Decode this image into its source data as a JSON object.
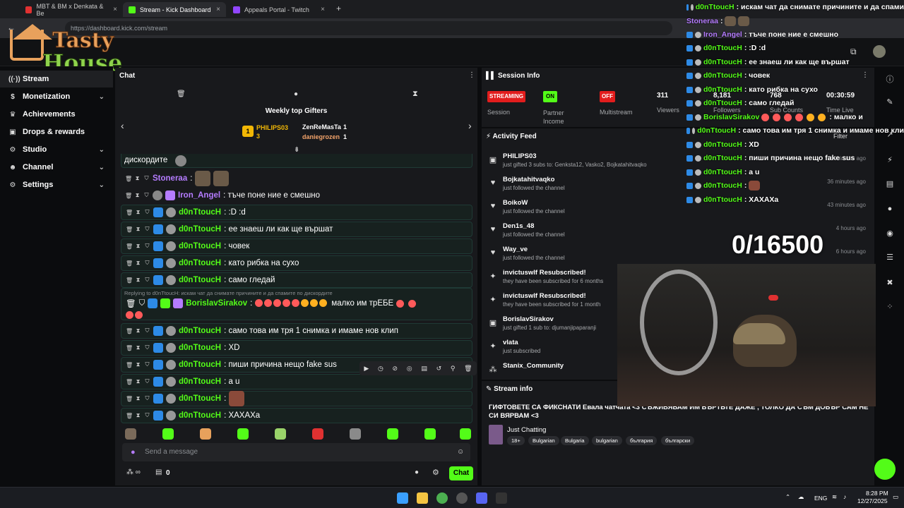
{
  "browser": {
    "tabs": [
      {
        "label": "MBT & BM x Denkata & Be",
        "fav": "#e03131"
      },
      {
        "label": "Stream - Kick Dashboard",
        "fav": "#53fc18"
      },
      {
        "label": "Appeals Portal - Twitch",
        "fav": "#9146ff"
      }
    ],
    "new_tab": "+",
    "url": "https://dashboard.kick.com/stream"
  },
  "overlay_logo": {
    "line1": "Tasty",
    "line2": "House"
  },
  "sidebar": {
    "items": [
      {
        "label": "Stream",
        "icon": "broadcast-icon",
        "glyph": "(·)",
        "chevron": ""
      },
      {
        "label": "Monetization",
        "icon": "dollar-icon",
        "glyph": "$",
        "chevron": "⌄"
      },
      {
        "label": "Achievements",
        "icon": "trophy-icon",
        "glyph": "🏆",
        "chevron": ""
      },
      {
        "label": "Drops & rewards",
        "icon": "gift-icon",
        "glyph": "🎁",
        "chevron": ""
      },
      {
        "label": "Studio",
        "icon": "gear-icon",
        "glyph": "⚙",
        "chevron": "⌄"
      },
      {
        "label": "Channel",
        "icon": "user-icon",
        "glyph": "👤",
        "chevron": "⌄"
      },
      {
        "label": "Settings",
        "icon": "gear-icon",
        "glyph": "⚙",
        "chevron": "⌄"
      }
    ]
  },
  "chat": {
    "title": "Chat",
    "gifters_title": "Weekly top Gifters",
    "gifters": [
      {
        "rank": "1",
        "name": "PHILIPS03",
        "count": "3"
      },
      {
        "name": "ZenReMasTa",
        "count": "1"
      },
      {
        "name": "daniegrozen",
        "count": "1"
      }
    ],
    "first_line": "дискордите",
    "messages": [
      {
        "user": "Stoneraa",
        "text": ":",
        "color": "purple"
      },
      {
        "user": "Iron_Angel",
        "text": ": тъче поне ние е смешно",
        "color": "purple"
      },
      {
        "user": "d0nTtoucH",
        "text": ": :D :d",
        "color": "green"
      },
      {
        "user": "d0nTtoucH",
        "text": ": ее знаеш ли как ще вършат",
        "color": "green"
      },
      {
        "user": "d0nTtoucH",
        "text": ": човек",
        "color": "green"
      },
      {
        "user": "d0nTtoucH",
        "text": ": като рибка на сухо",
        "color": "green"
      },
      {
        "user": "d0nTtoucH",
        "text": ": само гледай",
        "color": "green"
      }
    ],
    "reply_context": "Replying to d0nTtoucH: искам чат да снимате причините и да спамите по дискордите",
    "reply_user": "BorislavSirakov",
    "reply_text": "малко им трЕБЕ",
    "messages2": [
      {
        "user": "d0nTtoucH",
        "text": ": само това им тря 1 снимка и имаме нов клип"
      },
      {
        "user": "d0nTtoucH",
        "text": ": XD"
      },
      {
        "user": "d0nTtoucH",
        "text": ": пиши причина нещо fake sus"
      },
      {
        "user": "d0nTtoucH",
        "text": ": a u"
      },
      {
        "user": "d0nTtoucH",
        "text": ":"
      },
      {
        "user": "d0nTtoucH",
        "text": ": ХАХАХа"
      }
    ],
    "send_placeholder": "Send a message",
    "chat_button": "Chat",
    "footer_count": "0"
  },
  "session": {
    "title": "Session Info",
    "streaming": "STREAMING",
    "on": "ON",
    "off": "OFF",
    "labels": {
      "session": "Session",
      "partner": "Partner Income",
      "multistream": "Multistream",
      "viewers": "Viewers",
      "followers": "Followers",
      "subs": "Sub Counts",
      "time": "Time Live"
    },
    "viewers": "311",
    "followers": "8,181",
    "subs": "768",
    "time_live": "00:30:59",
    "colors": {
      "streaming": "#e21d1d",
      "on": "#53fc18",
      "off": "#e21d1d"
    }
  },
  "activity": {
    "title": "Activity Feed",
    "filter": "Filter",
    "items": [
      {
        "icon": "gift-icon",
        "name": "PHILIPS03",
        "desc": "just gifted 3 subs to: Genksta12, Vasko2, Bojkatahitvaqko",
        "time": "18 minutes ago"
      },
      {
        "icon": "heart-icon",
        "name": "Bojkatahitvaqko",
        "desc": "just followed the channel",
        "time": "36 minutes ago"
      },
      {
        "icon": "heart-icon",
        "name": "BoikoW",
        "desc": "just followed the channel",
        "time": "43 minutes ago"
      },
      {
        "icon": "heart-icon",
        "name": "Den1s_48",
        "desc": "just followed the channel",
        "time": "4 hours ago"
      },
      {
        "icon": "heart-icon",
        "name": "Way_ve",
        "desc": "just followed the channel",
        "time": "6 hours ago"
      },
      {
        "icon": "star-icon",
        "name": "invictuswlf Resubscribed!",
        "desc": "they have been subscribed for 6 months",
        "time": ""
      },
      {
        "icon": "star-icon",
        "name": "invictuswlf Resubscribed!",
        "desc": "they have been subscribed for 1 month",
        "time": ""
      },
      {
        "icon": "gift-icon",
        "name": "BorislavSirakov",
        "desc": "just gifted 1 sub to: djumanjipaparanji",
        "time": ""
      },
      {
        "icon": "star-icon",
        "name": "vlata",
        "desc": "just subscribed",
        "time": ""
      },
      {
        "icon": "users-icon",
        "name": "Stanix_Community",
        "desc": "",
        "time": ""
      }
    ]
  },
  "stream_info": {
    "title": "Stream info",
    "text": "ГИФТОВЕТЕ СА ФИКСНАТИ Евала чатчата <3 СЪЖИВЯВАМ ИМ ВЪРТЬТЕ ДАЖЕ , ТОЛКО ДА СЪМ ДОВЪР САМ НЕ СИ ВЯРВАМ <3",
    "category": "Just Chatting",
    "tags": [
      "18+",
      "Bulgarian",
      "Bulgaria",
      "bulgarian",
      "българия",
      "български"
    ]
  },
  "overlay": {
    "counter": "0/16500",
    "lines": [
      {
        "user": "d0nTtoucH",
        "text": ": искам чат да снимате причините и да спами"
      },
      {
        "user": "Stoneraa",
        "text": ":"
      },
      {
        "user": "Iron_Angel",
        "text": ": тъче поне ние е смешно"
      },
      {
        "user": "d0nTtoucH",
        "text": ": :D :d"
      },
      {
        "user": "d0nTtoucH",
        "text": ": ее знаеш ли как ще вършат"
      },
      {
        "user": "d0nTtoucH",
        "text": ": човек"
      },
      {
        "user": "d0nTtoucH",
        "text": ": като рибка на сухо"
      },
      {
        "user": "d0nTtoucH",
        "text": ": само гледай"
      },
      {
        "user": "BorislavSirakov",
        "text": ": малко и"
      },
      {
        "user": "d0nTtoucH",
        "text": ": само това им тря 1 снимка и имаме нов кли"
      },
      {
        "user": "d0nTtoucH",
        "text": ": XD"
      },
      {
        "user": "d0nTtoucH",
        "text": ": пиши причина нещо fake sus"
      },
      {
        "user": "d0nTtoucH",
        "text": ": a u"
      },
      {
        "user": "d0nTtoucH",
        "text": ":"
      },
      {
        "user": "d0nTtoucH",
        "text": ": ХАХАХа"
      }
    ]
  },
  "taskbar": {
    "lang": "ENG",
    "time": "8:28 PM",
    "date": "12/27/2025"
  }
}
